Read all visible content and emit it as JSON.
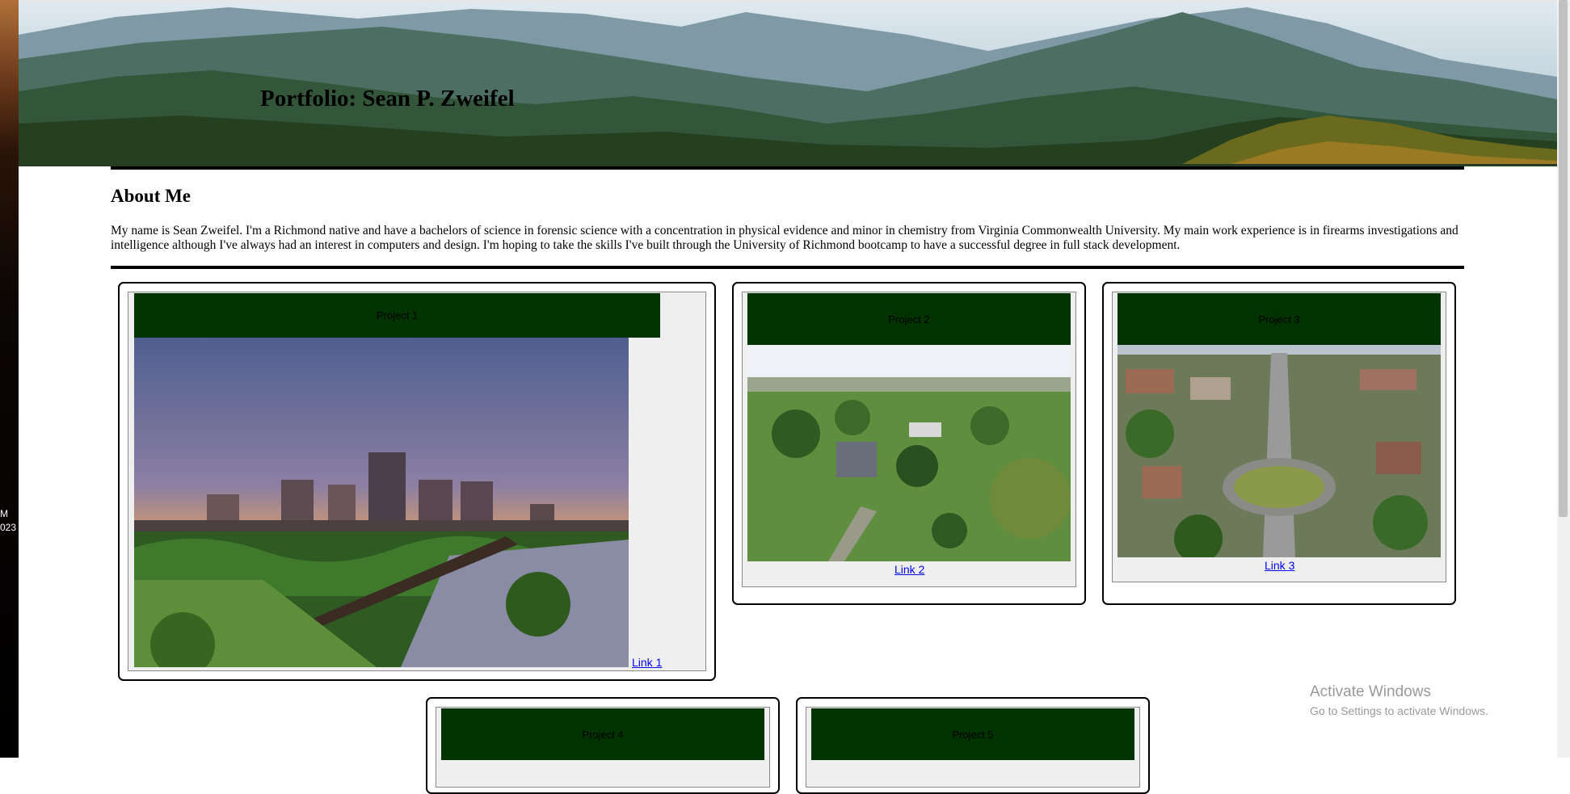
{
  "header": {
    "title": "Portfolio: Sean P. Zweifel"
  },
  "about": {
    "heading": "About Me",
    "text": "My name is Sean Zweifel. I'm a Richmond native and have a bachelors of science in forensic science with a concentration in physical evidence and minor in chemistry from Virginia Commonwealth University. My main work experience is in firearms investigations and intelligence although I've always had an interest in computers and design. I'm hoping to take the skills I've built through the University of Richmond bootcamp to have a successful degree in full stack development."
  },
  "projects": [
    {
      "title": "Project 1",
      "link": "Link 1"
    },
    {
      "title": "Project 2",
      "link": "Link 2"
    },
    {
      "title": "Project 3",
      "link": "Link 3"
    },
    {
      "title": "Project 4"
    },
    {
      "title": "Project 5"
    }
  ],
  "desktop": {
    "clock_line1": "M",
    "clock_line2": "023"
  },
  "watermark": {
    "title": "Activate Windows",
    "subtitle": "Go to Settings to activate Windows."
  },
  "colors": {
    "project_header": "#003300",
    "link": "#0000ee"
  },
  "icons": [
    "mountain-banner-image",
    "city-skyline-image",
    "campus-aerial-image",
    "neighborhood-aerial-image"
  ]
}
